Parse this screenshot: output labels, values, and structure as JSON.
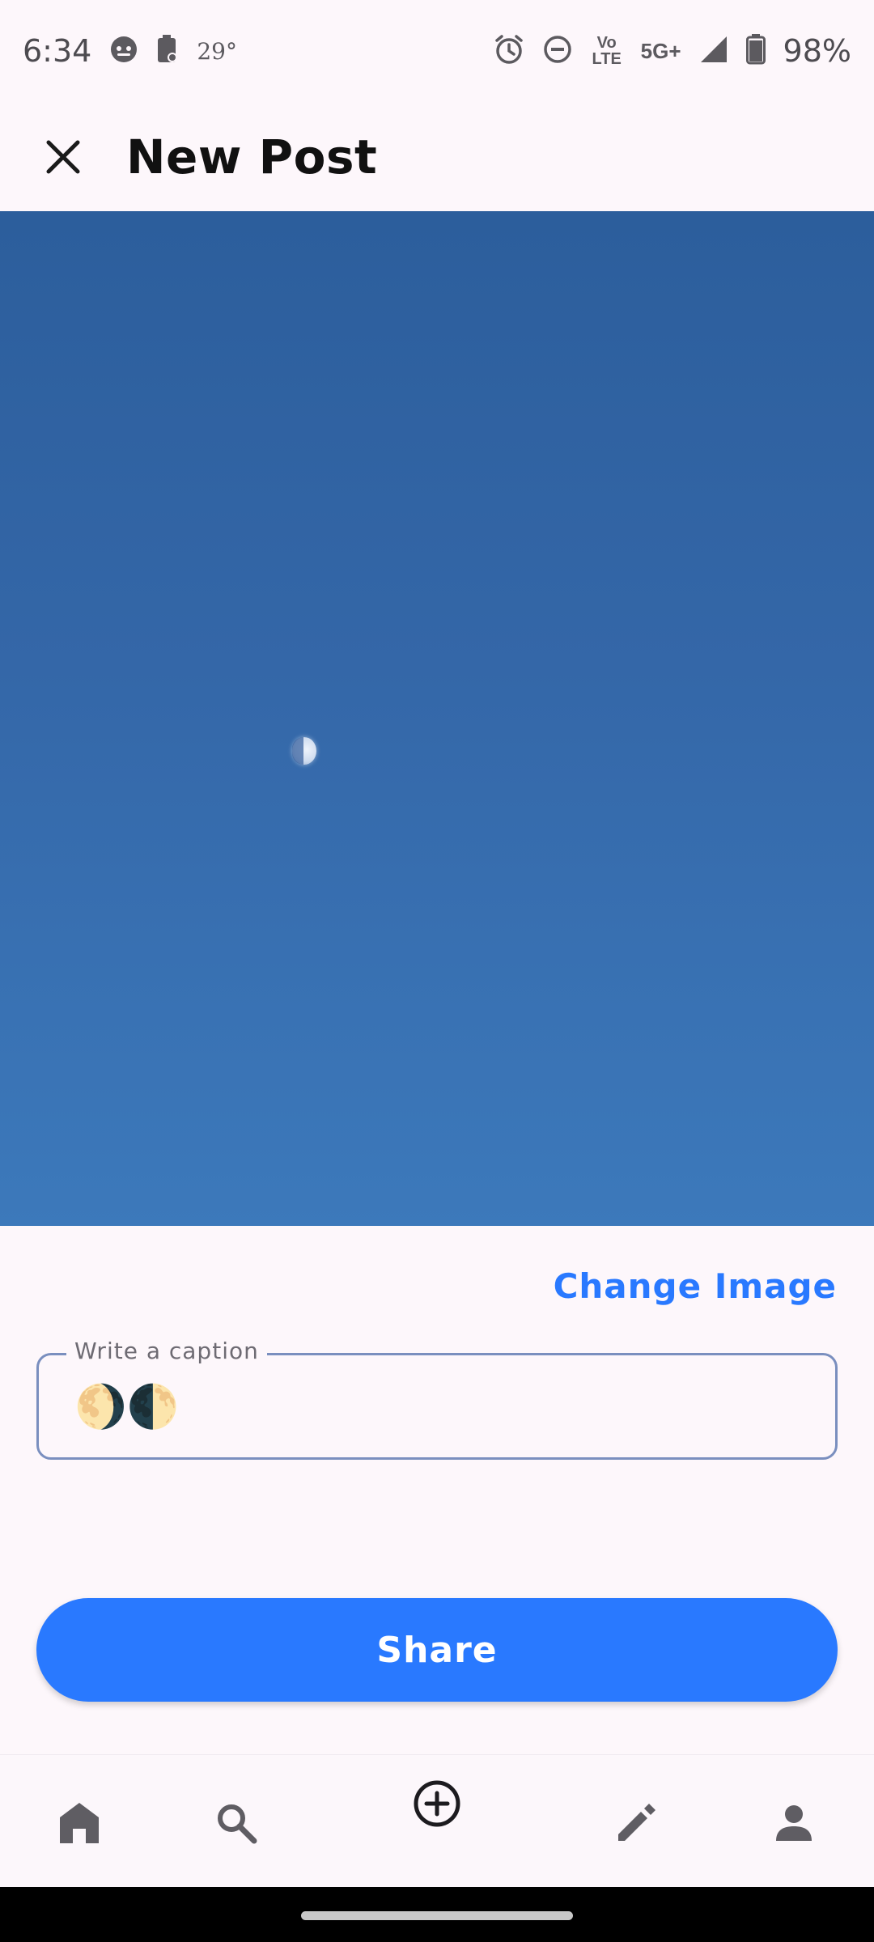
{
  "status_bar": {
    "time": "6:34",
    "temperature": "29°",
    "network_volte": "Vo LTE",
    "network_5g": "5G+",
    "battery": "98%"
  },
  "app_bar": {
    "title": "New Post",
    "close_icon": "close-icon"
  },
  "preview": {
    "image_description_icon": "moon-in-blue-sky"
  },
  "actions": {
    "change_image_label": "Change Image"
  },
  "caption": {
    "label": "Write a caption",
    "value": "🌖🌓"
  },
  "share": {
    "label": "Share"
  },
  "bottom_nav": {
    "items": [
      {
        "icon": "home-icon"
      },
      {
        "icon": "search-icon"
      },
      {
        "icon": "add-circle-icon"
      },
      {
        "icon": "edit-icon"
      },
      {
        "icon": "person-icon"
      }
    ]
  },
  "colors": {
    "accent": "#2979ff",
    "background": "#fdf7fb",
    "field_border": "#7a8fbf"
  }
}
